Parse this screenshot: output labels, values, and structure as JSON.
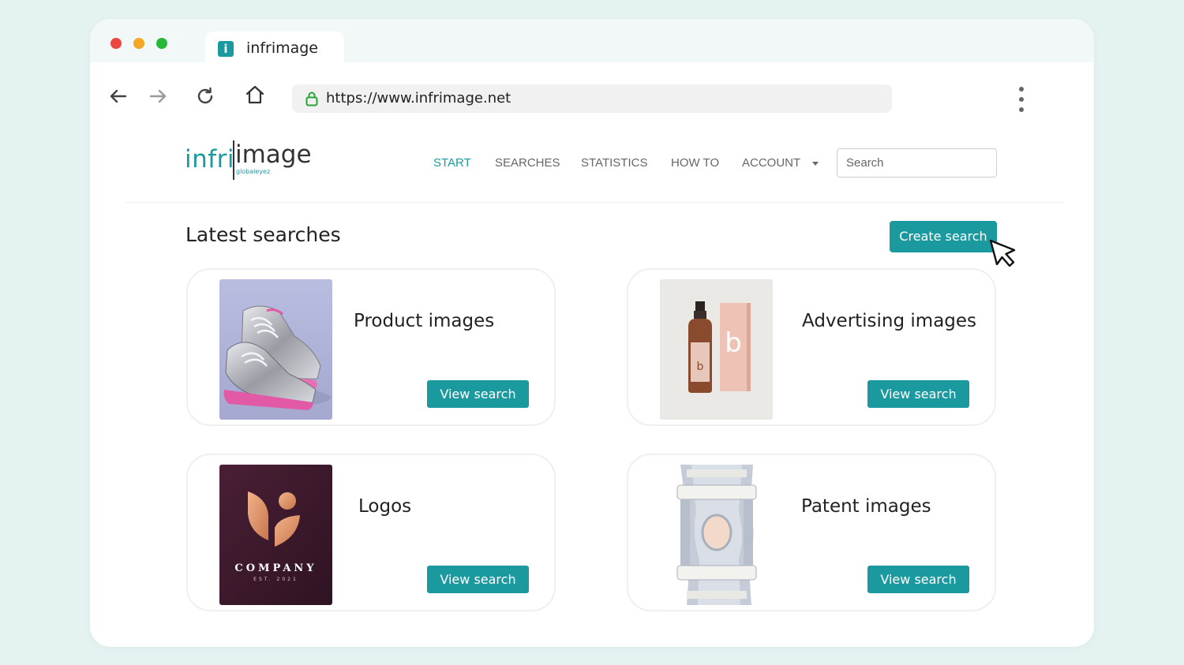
{
  "browser": {
    "tab_title": "infrimage",
    "tab_favicon": "i",
    "url": "https://www.infrimage.net"
  },
  "site": {
    "logo_part1": "infri",
    "logo_part2": "image",
    "logo_sub": "globaleyez"
  },
  "nav": {
    "items": [
      {
        "label": "START",
        "active": true
      },
      {
        "label": "SEARCHES"
      },
      {
        "label": "STATISTICS"
      },
      {
        "label": "HOW TO"
      },
      {
        "label": "ACCOUNT",
        "has_dropdown": true
      }
    ],
    "search_placeholder": "Search"
  },
  "main": {
    "title": "Latest searches",
    "create_button": "Create search",
    "cards": [
      {
        "title": "Product images",
        "button": "View search",
        "image": "sneakers-image"
      },
      {
        "title": "Advertising images",
        "button": "View search",
        "image": "cosmetic-bottle-image"
      },
      {
        "title": "Logos",
        "button": "View search",
        "image": "company-logo-image"
      },
      {
        "title": "Patent images",
        "button": "View search",
        "image": "knee-brace-image"
      }
    ]
  },
  "logo_card": {
    "text": "COMPANY",
    "sub": "EST. 2021"
  },
  "ad_card": {
    "letter": "b"
  },
  "colors": {
    "accent": "#1a9a9f",
    "background": "#e4f3f2"
  }
}
